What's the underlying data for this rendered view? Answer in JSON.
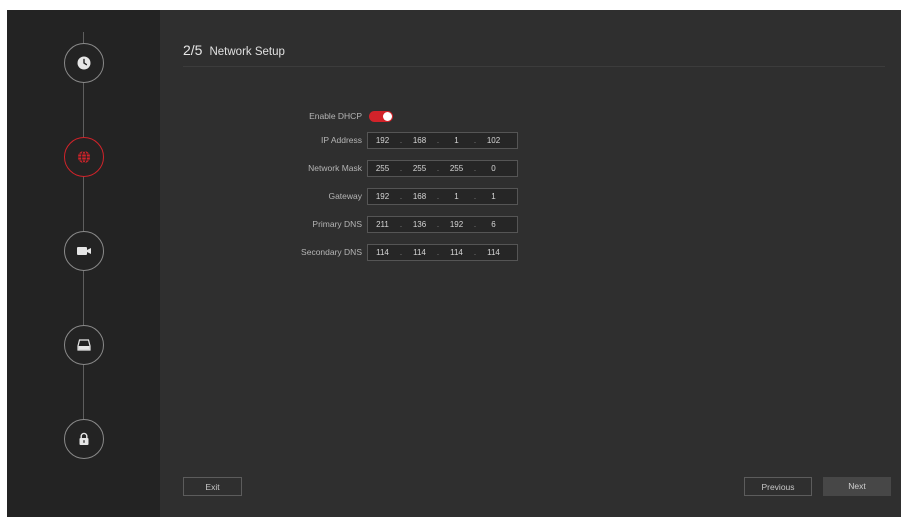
{
  "wizard": {
    "steps": [
      {
        "id": "time",
        "icon": "clock-icon",
        "active": false
      },
      {
        "id": "network",
        "icon": "globe-icon",
        "active": true
      },
      {
        "id": "camera",
        "icon": "camera-icon",
        "active": false
      },
      {
        "id": "disk",
        "icon": "hard-disk-icon",
        "active": false
      },
      {
        "id": "password",
        "icon": "lock-icon",
        "active": false
      }
    ],
    "step_number": "2/5",
    "title": "Network Setup"
  },
  "colors": {
    "accent": "#d2232a",
    "background": "#2f2f2f",
    "sidebar": "#232323"
  },
  "form": {
    "dhcp_label": "Enable DHCP",
    "dhcp_enabled": true,
    "fields": [
      {
        "label": "IP Address",
        "octets": [
          "192",
          "168",
          "1",
          "102"
        ]
      },
      {
        "label": "Network Mask",
        "octets": [
          "255",
          "255",
          "255",
          "0"
        ]
      },
      {
        "label": "Gateway",
        "octets": [
          "192",
          "168",
          "1",
          "1"
        ]
      },
      {
        "label": "Primary DNS",
        "octets": [
          "211",
          "136",
          "192",
          "6"
        ]
      },
      {
        "label": "Secondary DNS",
        "octets": [
          "114",
          "114",
          "114",
          "114"
        ]
      }
    ],
    "separator": "."
  },
  "footer": {
    "exit_label": "Exit",
    "previous_label": "Previous",
    "next_label": "Next"
  }
}
